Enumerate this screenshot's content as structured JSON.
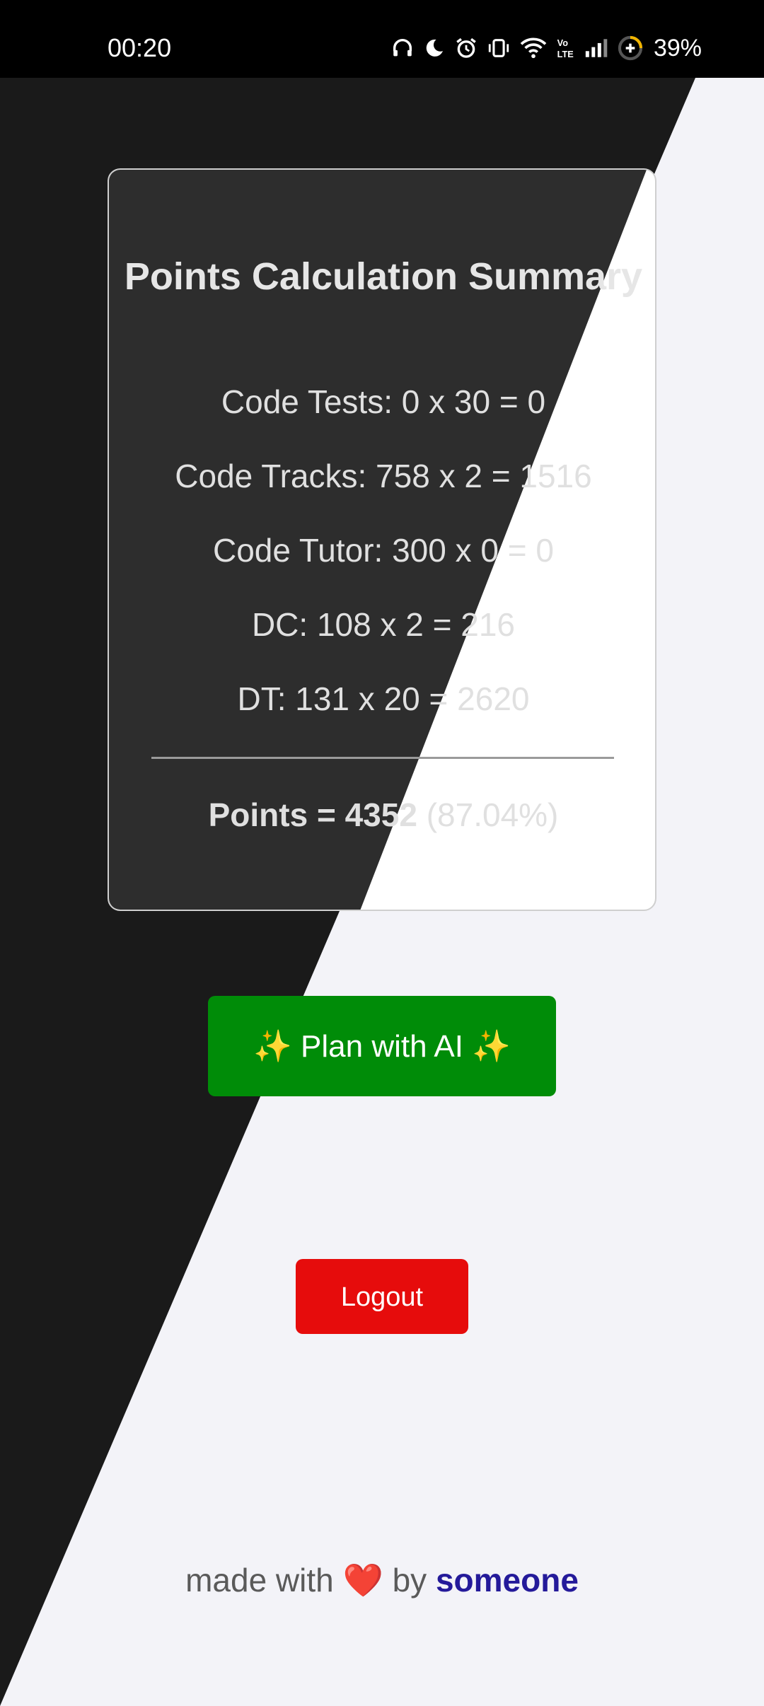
{
  "status_bar": {
    "time": "00:20",
    "battery": "39%",
    "icons": [
      "headphones-icon",
      "moon-icon",
      "alarm-icon",
      "vibrate-icon",
      "wifi-icon",
      "volte-icon",
      "signal-icon",
      "battery-icon"
    ]
  },
  "summary_card": {
    "title": "Points Calculation Summary",
    "rows": [
      "Code Tests: 0 x 30 = 0",
      "Code Tracks: 758 x 2 = 1516",
      "Code Tutor: 300 x 0 = 0",
      "DC: 108 x 2 = 216",
      "DT: 131 x 20 = 2620"
    ],
    "total_label": "Points = 4352",
    "total_percent": "(87.04%)"
  },
  "actions": {
    "plan_ai_label": "Plan with AI",
    "plan_ai_sparkle": "✨",
    "logout_label": "Logout"
  },
  "footer": {
    "prefix": "made with",
    "heart": "❤️",
    "by": "by",
    "author": "someone"
  },
  "colors": {
    "dark_bg": "#1a1a1a",
    "card_dark": "#2d2d2d",
    "light_bg": "#f3f3f8",
    "ai_button": "#008c08",
    "logout_button": "#e60c0c",
    "author_link": "#241a9a"
  }
}
